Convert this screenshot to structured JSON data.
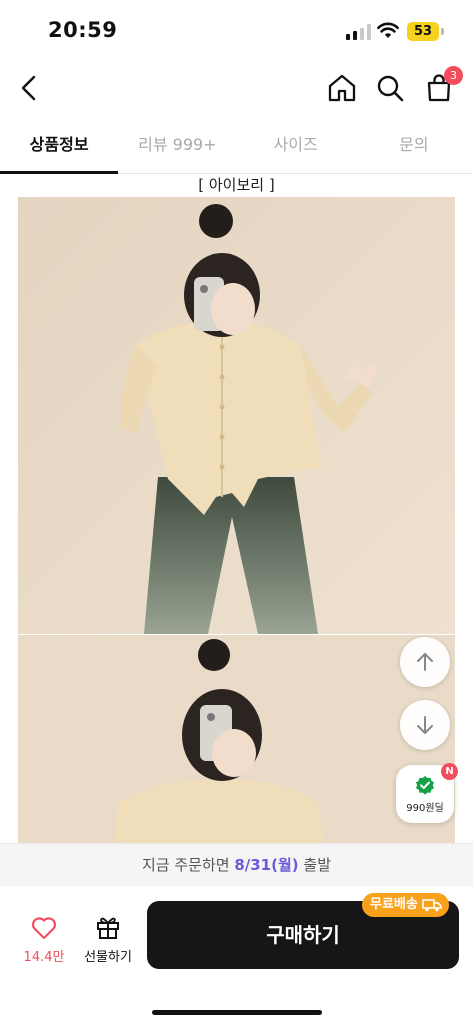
{
  "status_bar": {
    "time": "20:59",
    "battery": "53"
  },
  "nav": {
    "cart_count": "3"
  },
  "tabs": [
    {
      "label": "상품정보",
      "active": true
    },
    {
      "label": "리뷰 999+",
      "active": false
    },
    {
      "label": "사이즈",
      "active": false
    },
    {
      "label": "문의",
      "active": false
    }
  ],
  "product": {
    "color_option_label": "[ 아이보리 ]"
  },
  "floating": {
    "deal_label": "990원딜",
    "deal_badge": "N"
  },
  "delivery": {
    "prefix": "지금 주문하면 ",
    "date": "8/31(월)",
    "suffix": " 출발"
  },
  "bottom_bar": {
    "like_count": "14.4만",
    "gift_label": "선물하기",
    "buy_label": "구매하기",
    "free_shipping_badge": "무료배송"
  },
  "colors": {
    "accent_red": "#f44b5d",
    "delivery_date": "#6a5bd8",
    "shipping_badge": "#f9a11b",
    "buy_button": "#161616"
  }
}
